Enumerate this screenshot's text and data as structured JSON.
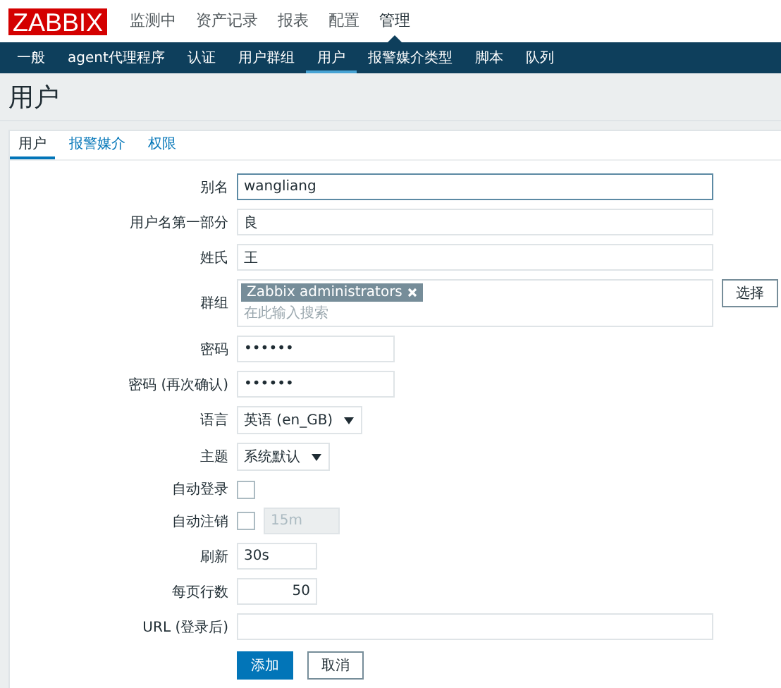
{
  "logo": "ZABBIX",
  "top_menu": [
    {
      "label": "监测中",
      "selected": false
    },
    {
      "label": "资产记录",
      "selected": false
    },
    {
      "label": "报表",
      "selected": false
    },
    {
      "label": "配置",
      "selected": false
    },
    {
      "label": "管理",
      "selected": true
    }
  ],
  "sub_menu": [
    {
      "label": "一般",
      "selected": false
    },
    {
      "label": "agent代理程序",
      "selected": false
    },
    {
      "label": "认证",
      "selected": false
    },
    {
      "label": "用户群组",
      "selected": false
    },
    {
      "label": "用户",
      "selected": true
    },
    {
      "label": "报警媒介类型",
      "selected": false
    },
    {
      "label": "脚本",
      "selected": false
    },
    {
      "label": "队列",
      "selected": false
    }
  ],
  "page_title": "用户",
  "tabs": [
    {
      "label": "用户",
      "selected": true
    },
    {
      "label": "报警媒介",
      "selected": false
    },
    {
      "label": "权限",
      "selected": false
    }
  ],
  "form": [
    {
      "kind": "text",
      "label": "别名",
      "value": "wangliang",
      "focused": true
    },
    {
      "kind": "text",
      "label": "用户名第一部分",
      "value": "良",
      "focused": false
    },
    {
      "kind": "text",
      "label": "姓氏",
      "value": "王",
      "focused": false
    },
    {
      "kind": "multiselect",
      "label": "群组",
      "tags": [
        "Zabbix administrators"
      ],
      "placeholder": "在此输入搜索",
      "button": "选择"
    },
    {
      "kind": "password",
      "label": "密码",
      "value": "••••••"
    },
    {
      "kind": "password",
      "label": "密码 (再次确认)",
      "value": "••••••"
    },
    {
      "kind": "select",
      "label": "语言",
      "value": "英语 (en_GB)"
    },
    {
      "kind": "select",
      "label": "主题",
      "value": "系统默认"
    },
    {
      "kind": "checkbox",
      "label": "自动登录",
      "checked": false
    },
    {
      "kind": "checkbox",
      "label": "自动注销",
      "checked": false,
      "value": "15m",
      "disabled": true
    },
    {
      "kind": "short",
      "label": "刷新",
      "value": "30s"
    },
    {
      "kind": "number",
      "label": "每页行数",
      "value": "50"
    },
    {
      "kind": "text",
      "label": "URL (登录后)",
      "focused": false
    }
  ],
  "buttons": [
    {
      "label": "添加",
      "primary": true
    },
    {
      "label": "取消",
      "primary": false
    }
  ]
}
